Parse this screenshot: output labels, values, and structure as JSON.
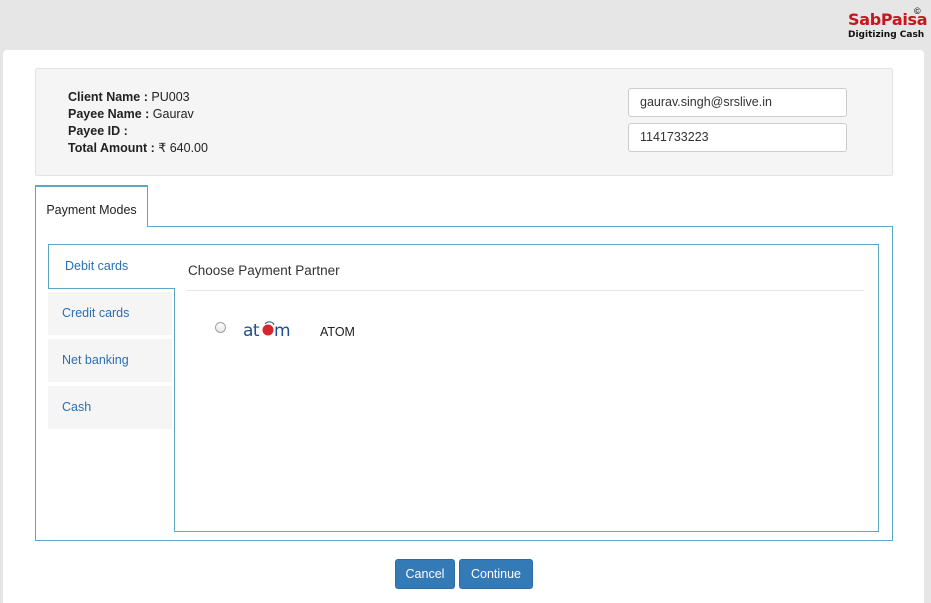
{
  "brand": {
    "logo_text": "SabPaisa",
    "copyright_mark": "©",
    "tagline": "Digitizing Cash",
    "color": "#c8161d"
  },
  "client": {
    "client_name_label": "Client Name :",
    "client_name_value": "PU003",
    "payee_name_label": "Payee Name :",
    "payee_name_value": "Gaurav",
    "payee_id_label": "Payee ID :",
    "payee_id_value": "",
    "total_amount_label": "Total Amount :",
    "total_amount_value": "₹ 640.00",
    "email_value": "gaurav.singh@srslive.in",
    "phone_value": "1141733223"
  },
  "tabs": [
    {
      "label": "Payment Modes",
      "active": true
    }
  ],
  "payment_modes": [
    {
      "label": "Debit cards",
      "active": true
    },
    {
      "label": "Credit cards",
      "active": false
    },
    {
      "label": "Net banking",
      "active": false
    },
    {
      "label": "Cash",
      "active": false
    }
  ],
  "partner_section": {
    "title": "Choose Payment Partner",
    "partners": [
      {
        "logo": "atom-logo",
        "name": "ATOM",
        "selected": false
      }
    ]
  },
  "actions": {
    "cancel_label": "Cancel",
    "continue_label": "Continue"
  },
  "colors": {
    "accent_border": "#5aa9c4",
    "primary_button": "#337ab7",
    "link_blue": "#2a6fb0"
  }
}
